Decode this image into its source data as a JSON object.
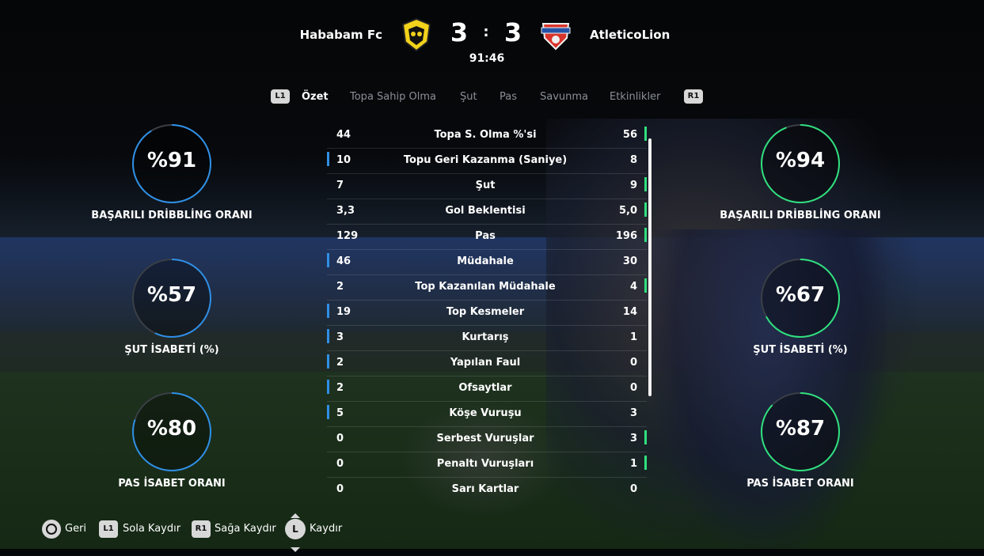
{
  "match": {
    "home_team": "Hababam Fc",
    "away_team": "AtleticoLion",
    "home_score": "3",
    "away_score": "3",
    "separator": ":",
    "clock": "91:46"
  },
  "tabs": {
    "prev_button": "L1",
    "next_button": "R1",
    "items": [
      {
        "label": "Özet",
        "active": true
      },
      {
        "label": "Topa Sahip Olma",
        "active": false
      },
      {
        "label": "Şut",
        "active": false
      },
      {
        "label": "Pas",
        "active": false
      },
      {
        "label": "Savunma",
        "active": false
      },
      {
        "label": "Etkinlikler",
        "active": false
      }
    ]
  },
  "stats": [
    {
      "label": "Topa S. Olma %'si",
      "home": "44",
      "away": "56",
      "leader": "away"
    },
    {
      "label": "Topu Geri Kazanma (Saniye)",
      "home": "10",
      "away": "8",
      "leader": "home"
    },
    {
      "label": "Şut",
      "home": "7",
      "away": "9",
      "leader": "away"
    },
    {
      "label": "Gol Beklentisi",
      "home": "3,3",
      "away": "5,0",
      "leader": "away"
    },
    {
      "label": "Pas",
      "home": "129",
      "away": "196",
      "leader": "away"
    },
    {
      "label": "Müdahale",
      "home": "46",
      "away": "30",
      "leader": "home"
    },
    {
      "label": "Top Kazanılan Müdahale",
      "home": "2",
      "away": "4",
      "leader": "away"
    },
    {
      "label": "Top Kesmeler",
      "home": "19",
      "away": "14",
      "leader": "home"
    },
    {
      "label": "Kurtarış",
      "home": "3",
      "away": "1",
      "leader": "home"
    },
    {
      "label": "Yapılan Faul",
      "home": "2",
      "away": "0",
      "leader": "home"
    },
    {
      "label": "Ofsaytlar",
      "home": "2",
      "away": "0",
      "leader": "home"
    },
    {
      "label": "Köşe Vuruşu",
      "home": "5",
      "away": "3",
      "leader": "home"
    },
    {
      "label": "Serbest Vuruşlar",
      "home": "0",
      "away": "3",
      "leader": "away"
    },
    {
      "label": "Penaltı Vuruşları",
      "home": "0",
      "away": "1",
      "leader": "away"
    },
    {
      "label": "Sarı Kartlar",
      "home": "0",
      "away": "0",
      "leader": "none"
    }
  ],
  "rings": {
    "home": [
      {
        "value": "%91",
        "percent": 91,
        "label": "BAŞARILI DRİBBLİNG ORANI"
      },
      {
        "value": "%57",
        "percent": 57,
        "label": "ŞUT İSABETİ (%)"
      },
      {
        "value": "%80",
        "percent": 80,
        "label": "PAS İSABET ORANI"
      }
    ],
    "away": [
      {
        "value": "%94",
        "percent": 94,
        "label": "BAŞARILI DRİBBLİNG ORANI"
      },
      {
        "value": "%67",
        "percent": 67,
        "label": "ŞUT İSABETİ (%)"
      },
      {
        "value": "%87",
        "percent": 87,
        "label": "PAS İSABET ORANI"
      }
    ]
  },
  "colors": {
    "home_accent": "#2e8fe6",
    "away_accent": "#2fe07e",
    "ring_track": "#3a3f46"
  },
  "footer": {
    "back_label": "Geri",
    "l1_button": "L1",
    "l1_label": "Sola Kaydır",
    "r1_button": "R1",
    "r1_label": "Sağa Kaydır",
    "stick_button": "L",
    "stick_label": "Kaydır"
  }
}
